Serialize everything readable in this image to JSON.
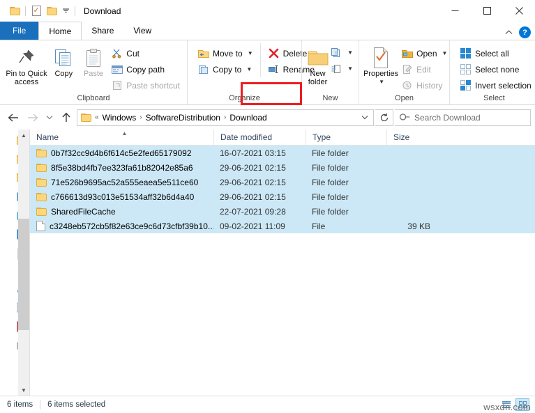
{
  "window": {
    "title": "Download",
    "quick_access": [
      "folder-icon",
      "properties-icon",
      "folder-icon",
      "dropdown-caret"
    ],
    "minimize": "—",
    "maximize": "☐",
    "close": "✕"
  },
  "tabs": [
    {
      "label": "File",
      "active": false,
      "style": "file"
    },
    {
      "label": "Home",
      "active": true,
      "style": "normal"
    },
    {
      "label": "Share",
      "active": false,
      "style": "normal"
    },
    {
      "label": "View",
      "active": false,
      "style": "normal"
    }
  ],
  "tab_right": {
    "collapse": "˄",
    "help": "?"
  },
  "ribbon": {
    "groups": [
      {
        "name": "Clipboard",
        "big": [
          {
            "label_line1": "Pin to Quick",
            "label_line2": "access",
            "icon": "pin-icon"
          },
          {
            "label_line1": "Copy",
            "label_line2": "",
            "icon": "copy-icon"
          },
          {
            "label_line1": "Paste",
            "label_line2": "",
            "icon": "paste-icon",
            "dim": true
          }
        ],
        "small": [
          {
            "label": "Cut",
            "icon": "scissors-icon",
            "dim": false
          },
          {
            "label": "Copy path",
            "icon": "copy-path-icon",
            "dim": false
          },
          {
            "label": "Paste shortcut",
            "icon": "paste-shortcut-icon",
            "dim": true
          }
        ]
      },
      {
        "name": "Organize",
        "small": [
          {
            "label": "Move to",
            "icon": "move-to-icon",
            "caret": true
          },
          {
            "label": "Copy to",
            "icon": "copy-to-icon",
            "caret": true
          }
        ],
        "small2": [
          {
            "label": "Delete",
            "icon": "delete-x-icon",
            "caret": true,
            "highlighted": true
          },
          {
            "label": "Rename",
            "icon": "rename-icon",
            "caret": false
          }
        ]
      },
      {
        "name": "New",
        "big": [
          {
            "label_line1": "New",
            "label_line2": "folder",
            "icon": "new-folder-icon"
          }
        ],
        "stack": [
          "new-item-icon",
          "easy-access-icon"
        ]
      },
      {
        "name": "Open",
        "big": [
          {
            "label_line1": "Properties",
            "label_line2": "",
            "icon": "properties-icon",
            "caret": true
          }
        ],
        "small": [
          {
            "label": "Open",
            "icon": "open-folder-icon",
            "caret": true,
            "dim": false
          },
          {
            "label": "Edit",
            "icon": "edit-icon",
            "caret": false,
            "dim": true
          },
          {
            "label": "History",
            "icon": "history-icon",
            "caret": false,
            "dim": true
          }
        ]
      },
      {
        "name": "Select",
        "small": [
          {
            "label": "Select all",
            "icon": "select-all-icon"
          },
          {
            "label": "Select none",
            "icon": "select-none-icon"
          },
          {
            "label": "Invert selection",
            "icon": "invert-selection-icon"
          }
        ]
      }
    ],
    "highlight_color": "#ee1c22"
  },
  "address": {
    "back": "←",
    "forward": "→",
    "recent": "˅",
    "up": "↑",
    "breadcrumb_prefix": "«",
    "breadcrumbs": [
      "Windows",
      "SoftwareDistribution",
      "Download"
    ],
    "separator": "›",
    "dropdown": "˅",
    "refresh": "↻",
    "search_placeholder": "Search Download",
    "search_value": ""
  },
  "columns": [
    {
      "label": "Name",
      "sorted": true,
      "sort_dir": "asc"
    },
    {
      "label": "Date modified",
      "sorted": false
    },
    {
      "label": "Type",
      "sorted": false
    },
    {
      "label": "Size",
      "sorted": false
    }
  ],
  "files": [
    {
      "name": "0b7f32cc9d4b6f614c5e2fed65179092",
      "date": "16-07-2021 03:15",
      "type": "File folder",
      "size": "",
      "icon": "folder-icon",
      "selected": true
    },
    {
      "name": "8f5e38bd4fb7ee323fa61b82042e85a6",
      "date": "29-06-2021 02:15",
      "type": "File folder",
      "size": "",
      "icon": "folder-icon",
      "selected": true
    },
    {
      "name": "71e526b9695ac52a555eaea5e511ce60",
      "date": "29-06-2021 02:15",
      "type": "File folder",
      "size": "",
      "icon": "folder-icon",
      "selected": true
    },
    {
      "name": "c766613d93c013e51534aff32b6d4a40",
      "date": "29-06-2021 02:15",
      "type": "File folder",
      "size": "",
      "icon": "folder-icon",
      "selected": true
    },
    {
      "name": "SharedFileCache",
      "date": "22-07-2021 09:28",
      "type": "File folder",
      "size": "",
      "icon": "folder-icon",
      "selected": true
    },
    {
      "name": "c3248eb572cb5f82e63ce9c6d73cfbf39b10...",
      "date": "09-02-2021 11:09",
      "type": "File",
      "size": "39 KB",
      "icon": "file-icon",
      "selected": true
    }
  ],
  "status": {
    "item_count": "6 items",
    "selection": "6 items selected"
  },
  "view_buttons": [
    {
      "name": "details-view",
      "active": false
    },
    {
      "name": "large-icons-view",
      "active": true
    }
  ],
  "watermark": "wsxdn.com"
}
